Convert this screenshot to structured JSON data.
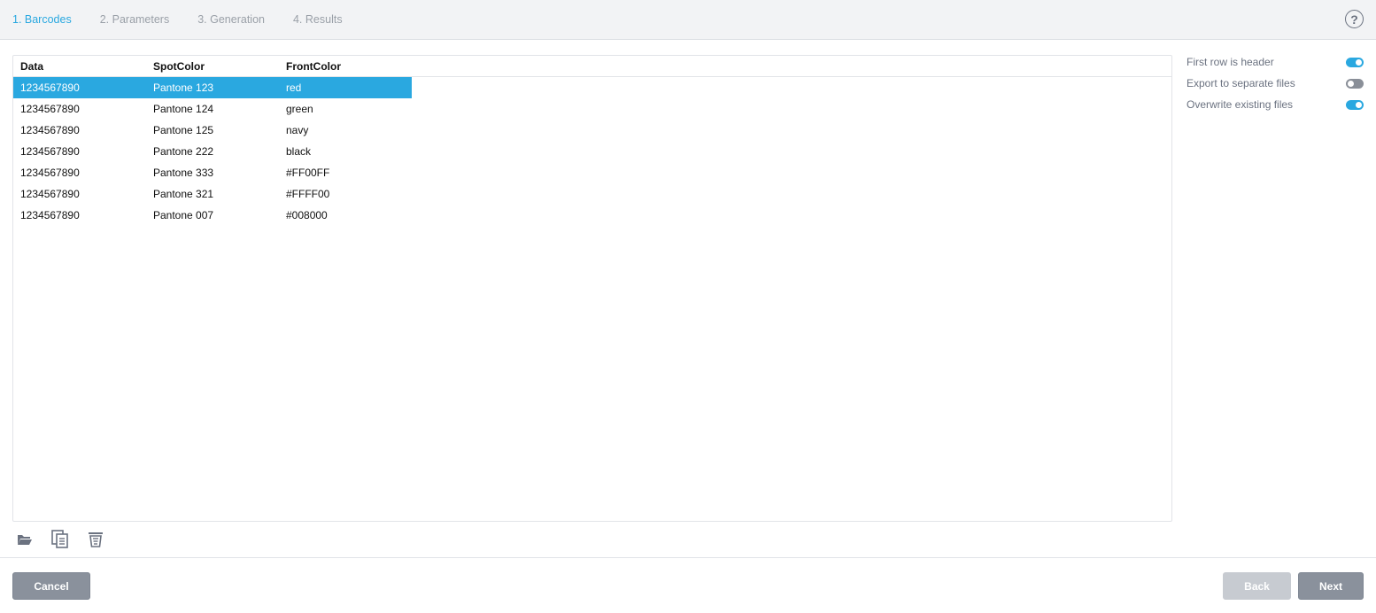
{
  "steps": [
    {
      "label": "1. Barcodes",
      "active": true
    },
    {
      "label": "2. Parameters",
      "active": false
    },
    {
      "label": "3. Generation",
      "active": false
    },
    {
      "label": "4. Results",
      "active": false
    }
  ],
  "help_icon": "question-circle-icon",
  "table": {
    "columns": [
      "Data",
      "SpotColor",
      "FrontColor"
    ],
    "rows": [
      [
        "1234567890",
        "Pantone 123",
        "red"
      ],
      [
        "1234567890",
        "Pantone 124",
        "green"
      ],
      [
        "1234567890",
        "Pantone 125",
        "navy"
      ],
      [
        "1234567890",
        "Pantone 222",
        "black"
      ],
      [
        "1234567890",
        "Pantone 333",
        "#FF00FF"
      ],
      [
        "1234567890",
        "Pantone 321",
        "#FFFF00"
      ],
      [
        "1234567890",
        "Pantone 007",
        "#008000"
      ]
    ],
    "selected_row": 0
  },
  "toolbar_icons": [
    "folder-open-icon",
    "copy-icon",
    "trash-icon"
  ],
  "options": [
    {
      "label": "First row is header",
      "on": true
    },
    {
      "label": "Export to separate files",
      "on": false
    },
    {
      "label": "Overwrite existing files",
      "on": true
    }
  ],
  "footer": {
    "cancel_label": "Cancel",
    "back_label": "Back",
    "next_label": "Next"
  },
  "colors": {
    "accent": "#2aa8e0",
    "button": "#8a919c",
    "button_disabled": "#c7cbd1"
  }
}
